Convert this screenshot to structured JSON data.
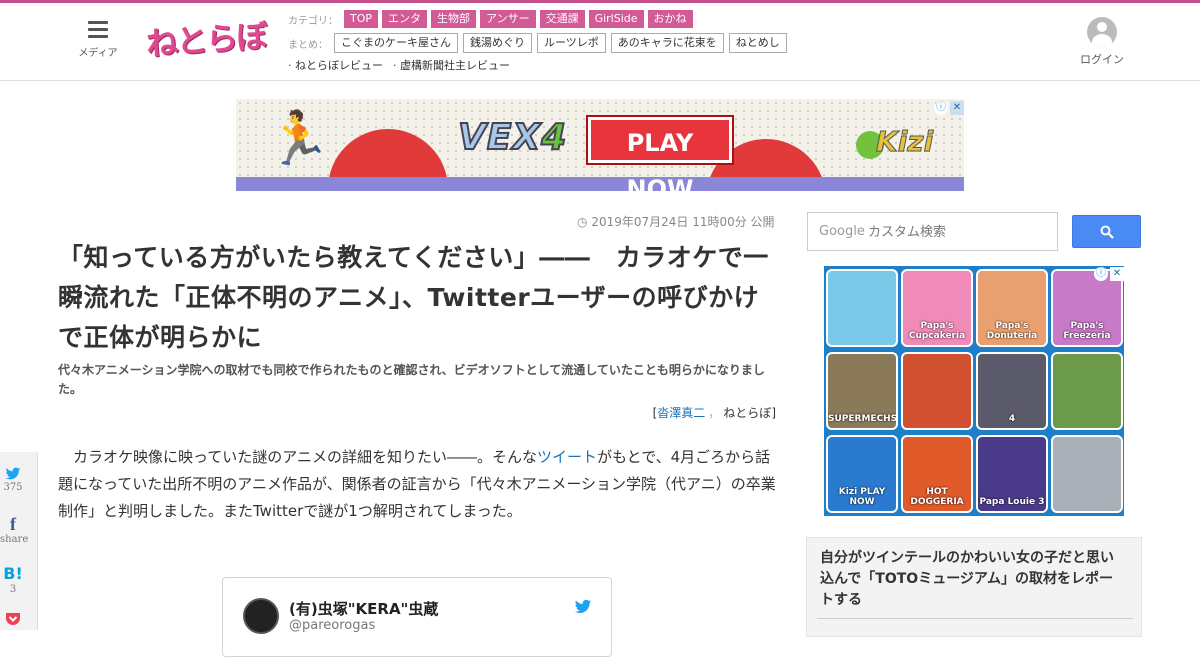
{
  "header": {
    "menu_label": "メディア",
    "logo_text": "ねとらぼ",
    "category_label": "カテゴリ：",
    "categories": [
      "TOP",
      "エンタ",
      "生物部",
      "アンサー",
      "交通課",
      "GirlSide",
      "おかね"
    ],
    "matome_label": "まとめ：",
    "matome": [
      "こぐまのケーキ屋さん",
      "銭湯めぐり",
      "ルーツレポ",
      "あのキャラに花束を",
      "ねとめし"
    ],
    "reviews": [
      "· ねとらぼレビュー",
      "· 虚構新聞社主レビュー"
    ],
    "login_label": "ログイン",
    "accent_color": "#d25a95"
  },
  "ad_banner": {
    "brand": "VEX",
    "brand_num": "4",
    "cta": "PLAY NOW",
    "sponsor": "Kizi",
    "info_icon": "ⓘ",
    "close_icon": "✕"
  },
  "article": {
    "published": "2019年07月24日 11時00分 公開",
    "headline": "「知っている方がいたら教えてください」――　カラオケで一瞬流れた「正体不明のアニメ」、Twitterユーザーの呼びかけで正体が明らかに",
    "lead": "代々木アニメーション学院への取材でも同校で作られたものと確認され、ビデオソフトとして流通していたことも明らかになりました。",
    "byline_open": "[",
    "author": "沓澤真二",
    "byline_sep": "，",
    "publication": "ねとらぼ",
    "byline_close": "]",
    "body_1": "カラオケ映像に映っていた謎のアニメの詳細を知りたい――。そんな",
    "body_link": "ツイート",
    "body_2": "がもとで、4月ごろから話題になっていた出所不明のアニメ作品が、関係者の証言から「代々木アニメーション学院（代アニ）の卒業制作」と判明しました。またTwitterで謎が1つ解明されてしまった。"
  },
  "tweet": {
    "name": "(有)虫塚\"KERA\"虫蔵",
    "handle": "@pareorogas"
  },
  "share": {
    "twitter_count": "375",
    "facebook_label": "share",
    "hatena_icon": "B!",
    "hatena_count": "3"
  },
  "sidebar": {
    "search_brand": "Google",
    "search_placeholder": "カスタム検索",
    "games": [
      {
        "title": "",
        "color": "#7ac8e8"
      },
      {
        "title": "Papa's Cupcakeria",
        "color": "#f08ab8"
      },
      {
        "title": "Papa's Donuteria",
        "color": "#e8a070"
      },
      {
        "title": "Papa's Freezeria",
        "color": "#c77ac8"
      },
      {
        "title": "SUPERMECHS",
        "color": "#8a7a5a"
      },
      {
        "title": "",
        "color": "#d05030"
      },
      {
        "title": "4",
        "color": "#5a5a6a"
      },
      {
        "title": "",
        "color": "#6a9a4a"
      },
      {
        "title": "Kizi PLAY NOW",
        "color": "#2a7ad0"
      },
      {
        "title": "HOT DOGGERIA",
        "color": "#e05a2a"
      },
      {
        "title": "Papa Louie 3",
        "color": "#4a3a8a"
      },
      {
        "title": "",
        "color": "#aab0b8"
      }
    ],
    "recommended_title": "自分がツインテールのかわいい女の子だと思い込んで「TOTOミュージアム」の取材をレポートする"
  }
}
